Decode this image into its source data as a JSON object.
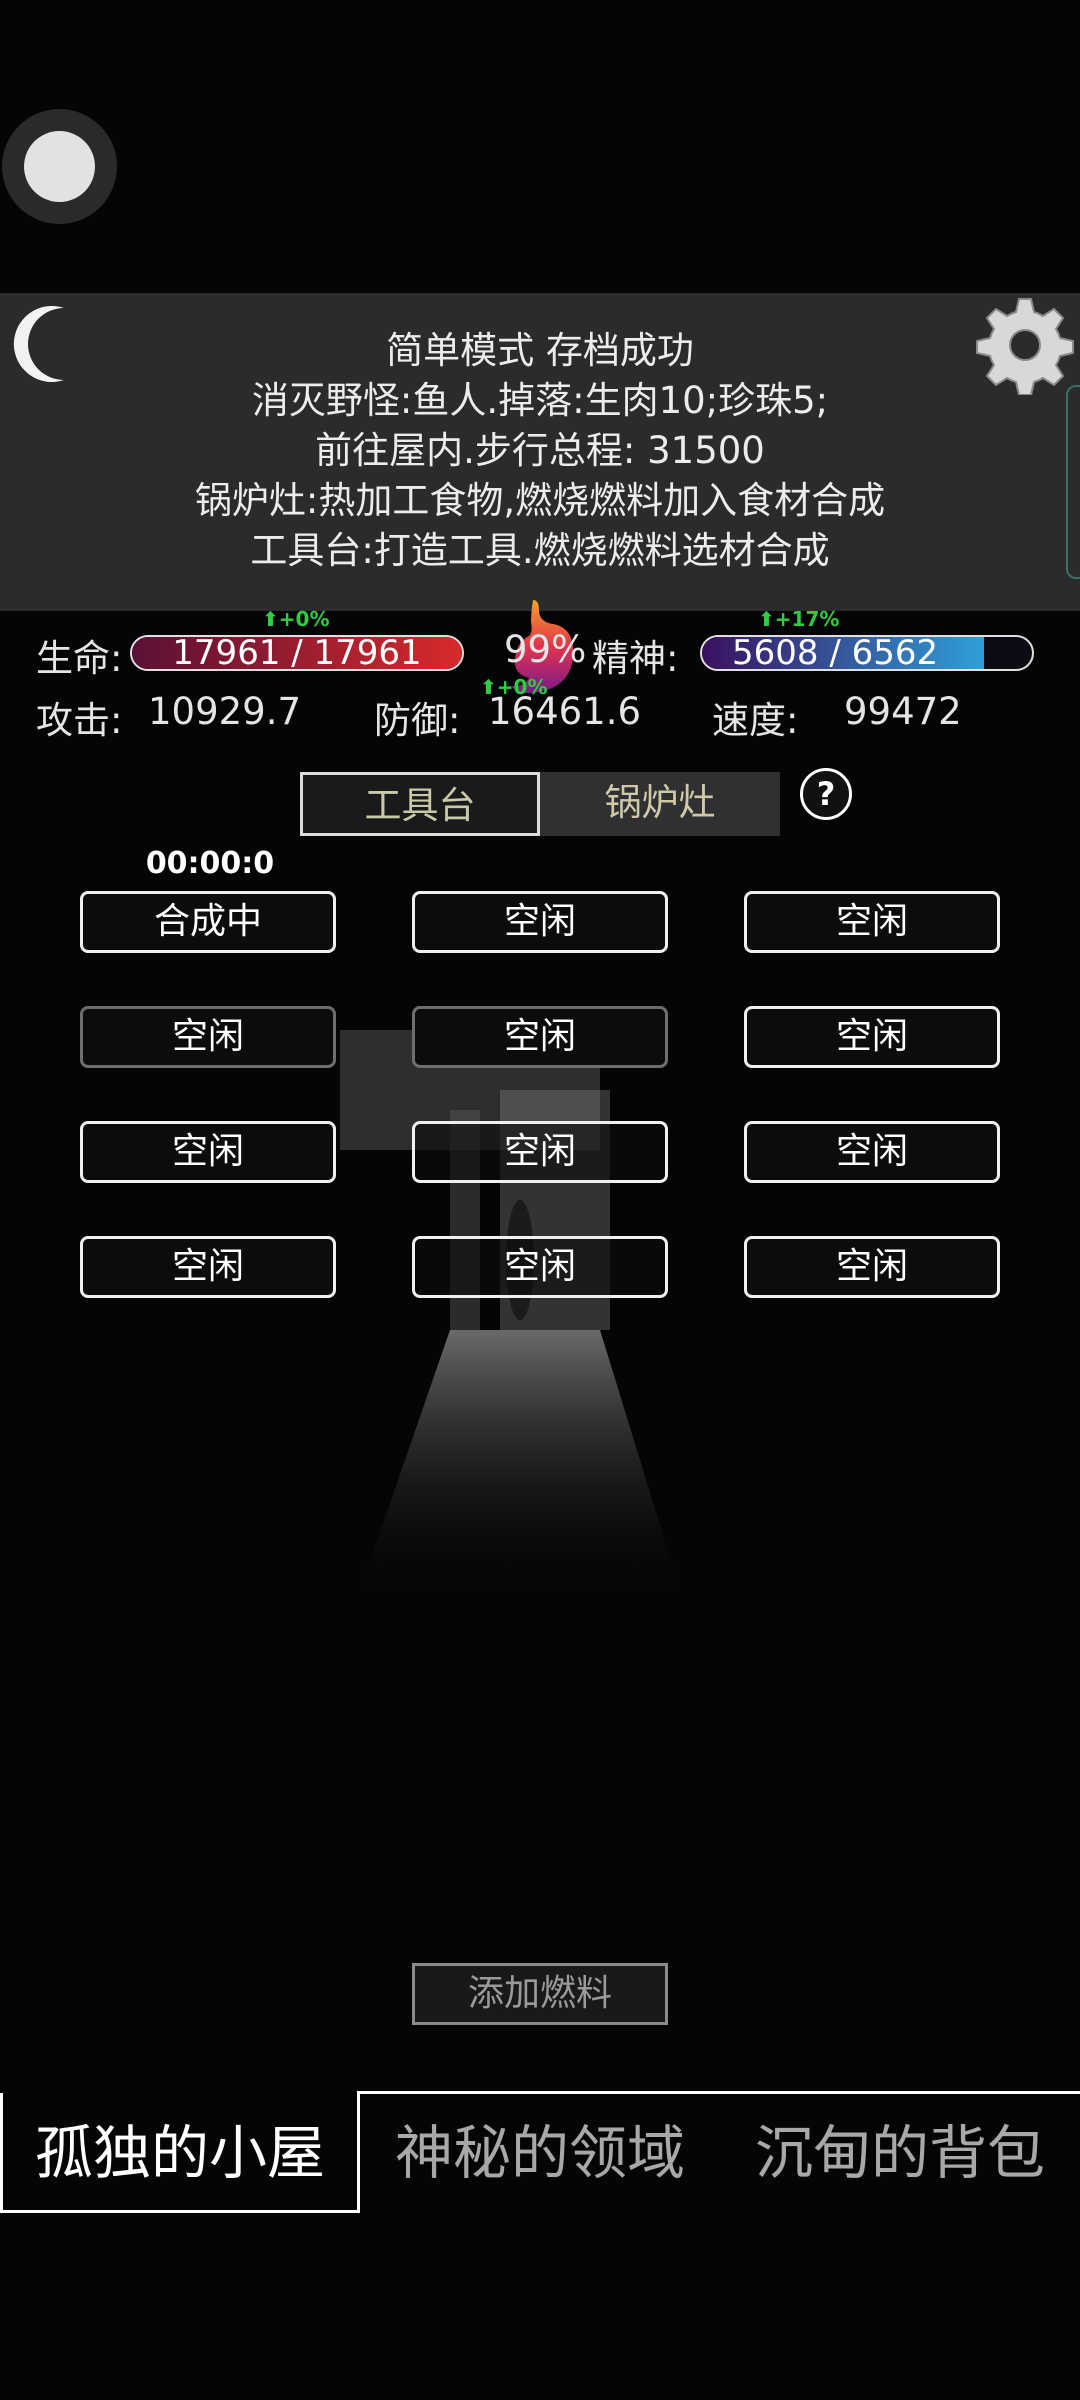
{
  "log": {
    "lines": [
      "简单模式 存档成功",
      "消灭野怪:鱼人.掉落:生肉10;珍珠5;",
      "前往屋内.步行总程: 31500",
      "锅炉灶:热加工食物,燃烧燃料加入食材合成",
      "工具台:打造工具.燃烧燃料选材合成"
    ]
  },
  "stats": {
    "life_label": "生命:",
    "life_text": "17961 / 17961",
    "life_fraction": 1.0,
    "life_buff": "+0%",
    "stomach_percent": "99%",
    "spirit_label": "精神:",
    "spirit_text": "5608 / 6562",
    "spirit_fraction": 0.855,
    "spirit_buff": "+17%",
    "attack_label": "攻击:",
    "attack_value": "10929.7",
    "defense_label": "防御:",
    "defense_value": "16461.6",
    "defense_buff": "+0%",
    "speed_label": "速度:",
    "speed_value": "99472"
  },
  "tabs": {
    "workbench": "工具台",
    "boiler": "锅炉灶",
    "help": "?"
  },
  "timer": "00:00:0",
  "slots": [
    "合成中",
    "空闲",
    "空闲",
    "空闲",
    "空闲",
    "空闲",
    "空闲",
    "空闲",
    "空闲",
    "空闲",
    "空闲",
    "空闲"
  ],
  "add_fuel": "添加燃料",
  "nav": {
    "cabin": "孤独的小屋",
    "domain": "神秘的领域",
    "bag": "沉甸的背包"
  },
  "colors": {
    "life_fill_start": "#5a1036",
    "life_fill_end": "#d82a2a",
    "spirit_fill_start": "#3a1060",
    "spirit_fill_end": "#2f9fd8",
    "buff_green": "#2ecc40"
  }
}
